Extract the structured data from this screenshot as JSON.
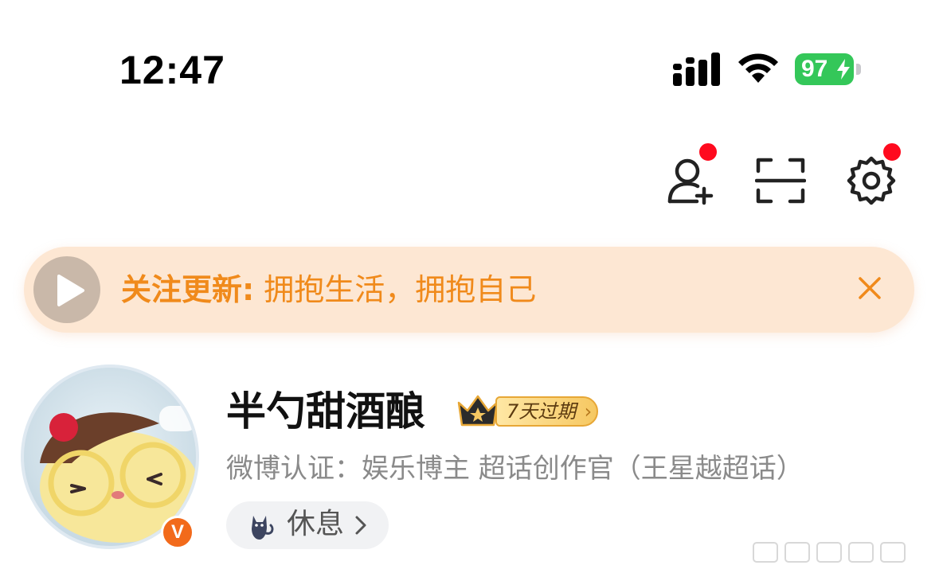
{
  "status_bar": {
    "time": "12:47",
    "battery_level": "97",
    "battery_charging": true,
    "signal": "full",
    "wifi": "full"
  },
  "top_actions": {
    "icons": [
      "add-friend-icon",
      "scan-icon",
      "settings-icon"
    ],
    "notification_dot_color": "#ff0a1e"
  },
  "banner": {
    "prefix": "关注更新:",
    "text": " 拥抱生活，拥抱自己",
    "accent_color": "#f08a1b",
    "background": "#fde7d3"
  },
  "profile": {
    "username": "半勺甜酒酿",
    "vip_tag": "7天过期",
    "verification": "微博认证：娱乐博主 超话创作官（王星越超话）",
    "verified_badge": "V",
    "status": {
      "label": "休息",
      "icon": "cat-icon"
    }
  }
}
